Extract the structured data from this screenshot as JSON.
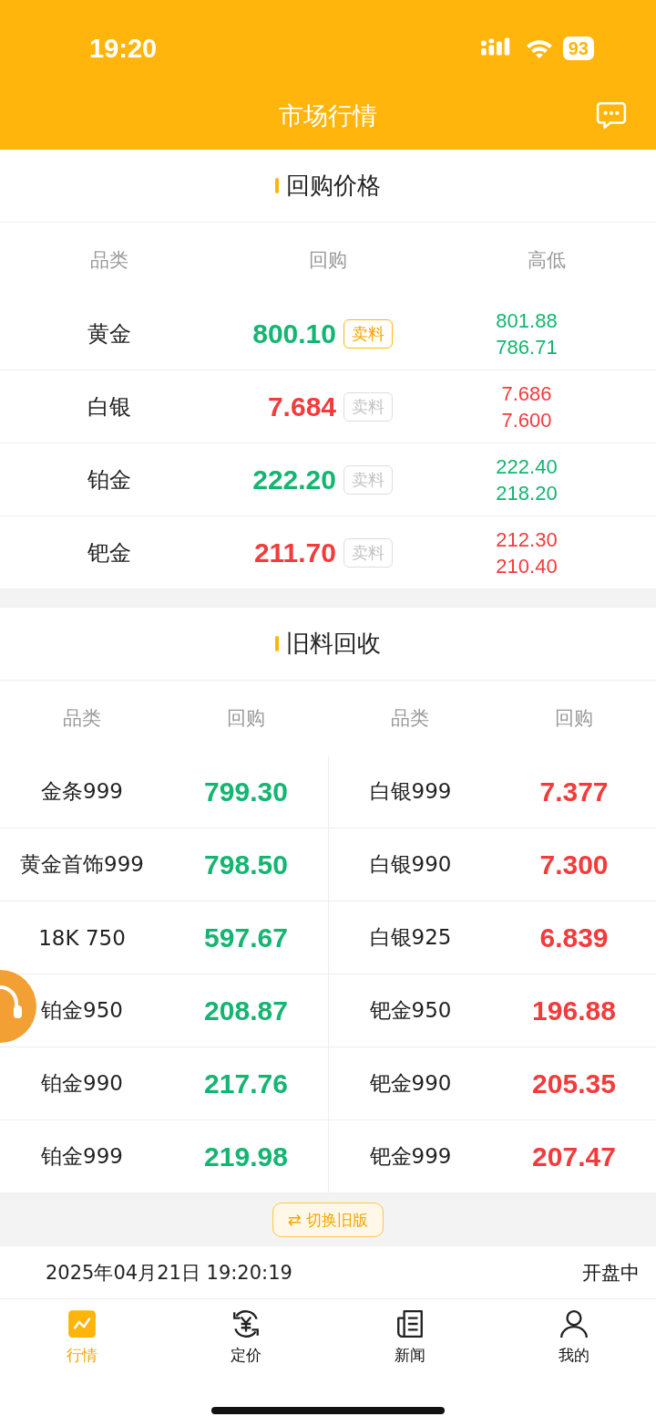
{
  "status_bar": {
    "time": "19:20",
    "battery": "93"
  },
  "header": {
    "title": "市场行情"
  },
  "buyback": {
    "title": "回购价格",
    "columns": [
      "品类",
      "回购",
      "高低"
    ],
    "rows": [
      {
        "name": "黄金",
        "price": "800.10",
        "color": "#14b571",
        "sell": {
          "label": "卖料",
          "disabled": false
        },
        "high": "801.88",
        "low": "786.71"
      },
      {
        "name": "白银",
        "price": "7.684",
        "color": "#f43b3b",
        "sell": {
          "label": "卖料",
          "disabled": true
        },
        "high": "7.686",
        "low": "7.600"
      },
      {
        "name": "铂金",
        "price": "222.20",
        "color": "#14b571",
        "sell": {
          "label": "卖料",
          "disabled": true
        },
        "high": "222.40",
        "low": "218.20"
      },
      {
        "name": "钯金",
        "price": "211.70",
        "color": "#f43b3b",
        "sell": {
          "label": "卖料",
          "disabled": true
        },
        "high": "212.30",
        "low": "210.40"
      }
    ]
  },
  "recycle": {
    "title": "旧料回收",
    "columns": [
      "品类",
      "回购",
      "品类",
      "回购"
    ],
    "rows": [
      [
        {
          "text": "金条999"
        },
        {
          "text": "799.30",
          "color": "#14b571"
        },
        {
          "text": "白银999"
        },
        {
          "text": "7.377",
          "color": "#f43b3b"
        }
      ],
      [
        {
          "text": "黄金首饰999"
        },
        {
          "text": "798.50",
          "color": "#14b571"
        },
        {
          "text": "白银990"
        },
        {
          "text": "7.300",
          "color": "#f43b3b"
        }
      ],
      [
        {
          "text": "18K 750"
        },
        {
          "text": "597.67",
          "color": "#14b571"
        },
        {
          "text": "白银925"
        },
        {
          "text": "6.839",
          "color": "#f43b3b"
        }
      ],
      [
        {
          "text": "铂金950"
        },
        {
          "text": "208.87",
          "color": "#14b571"
        },
        {
          "text": "钯金950"
        },
        {
          "text": "196.88",
          "color": "#f43b3b"
        }
      ],
      [
        {
          "text": "铂金990"
        },
        {
          "text": "217.76",
          "color": "#14b571"
        },
        {
          "text": "钯金990"
        },
        {
          "text": "205.35",
          "color": "#f43b3b"
        }
      ],
      [
        {
          "text": "铂金999"
        },
        {
          "text": "219.98",
          "color": "#14b571"
        },
        {
          "text": "钯金999"
        },
        {
          "text": "207.47",
          "color": "#f43b3b"
        }
      ]
    ]
  },
  "switch_button": {
    "icon": "⇄",
    "label": "切换旧版"
  },
  "footer": {
    "datetime": "2025年04月21日 19:20:19",
    "market_status": "开盘中"
  },
  "tabs": [
    {
      "kind": "chart",
      "label": "行情",
      "selected": true
    },
    {
      "kind": "price",
      "label": "定价",
      "selected": false
    },
    {
      "kind": "news",
      "label": "新闻",
      "selected": false
    },
    {
      "kind": "profile",
      "label": "我的",
      "selected": false
    }
  ]
}
